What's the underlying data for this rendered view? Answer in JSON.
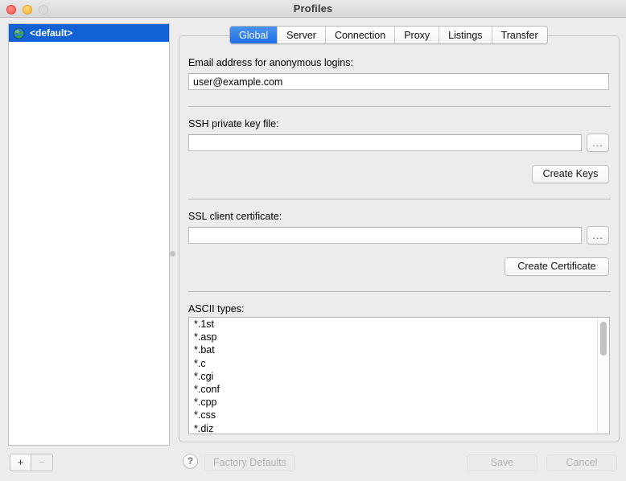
{
  "window": {
    "title": "Profiles",
    "traffic_lights": [
      "close",
      "minimize",
      "zoom"
    ]
  },
  "sidebar": {
    "profiles": [
      {
        "label": "<default>",
        "icon": "globe-icon",
        "selected": true
      }
    ],
    "add_label": "+",
    "remove_label": "−"
  },
  "tabs": [
    {
      "label": "Global",
      "active": true
    },
    {
      "label": "Server",
      "active": false
    },
    {
      "label": "Connection",
      "active": false
    },
    {
      "label": "Proxy",
      "active": false
    },
    {
      "label": "Listings",
      "active": false
    },
    {
      "label": "Transfer",
      "active": false
    }
  ],
  "global_tab": {
    "email": {
      "label": "Email address for anonymous logins:",
      "value": "user@example.com",
      "placeholder": ""
    },
    "ssh_key": {
      "label": "SSH private key file:",
      "value": "",
      "placeholder": "",
      "browse_label": "...",
      "action_label": "Create Keys"
    },
    "ssl_cert": {
      "label": "SSL client certificate:",
      "value": "",
      "placeholder": "",
      "browse_label": "...",
      "action_label": "Create Certificate"
    },
    "ascii_types": {
      "label": "ASCII types:",
      "items": [
        "*.1st",
        "*.asp",
        "*.bat",
        "*.c",
        "*.cgi",
        "*.conf",
        "*.cpp",
        "*.css",
        "*.diz"
      ]
    }
  },
  "footer": {
    "help_label": "?",
    "factory_defaults_label": "Factory Defaults",
    "save_label": "Save",
    "cancel_label": "Cancel"
  },
  "colors": {
    "accent": "#1262d6",
    "tab_active": "#1f6fe4",
    "window_bg": "#ececec",
    "field_bg": "#ffffff"
  }
}
